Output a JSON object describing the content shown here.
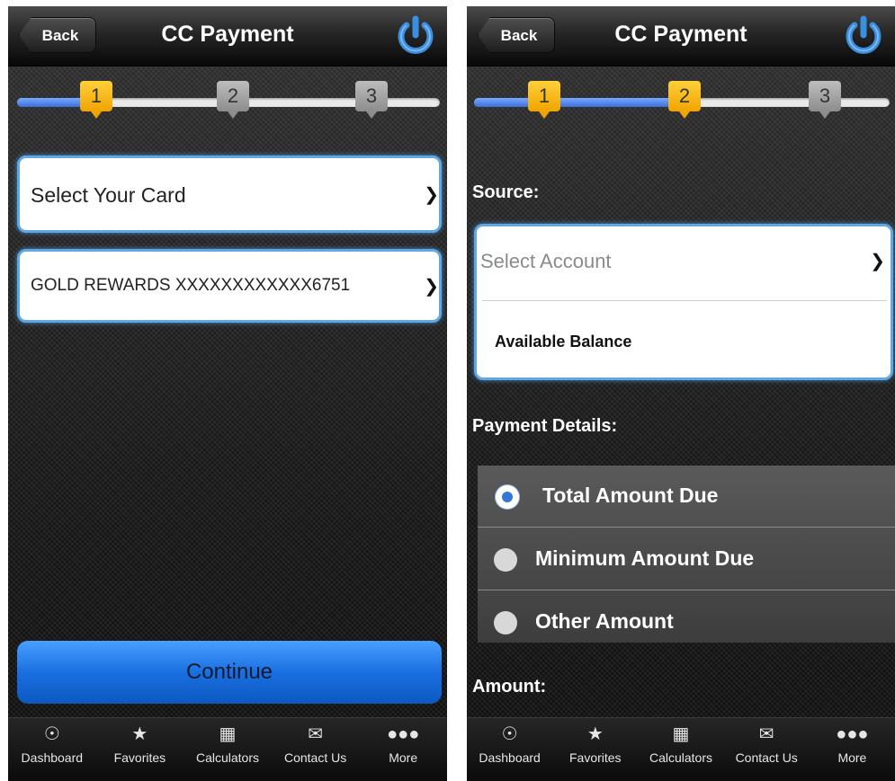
{
  "left": {
    "header": {
      "back_label": "Back",
      "title": "CC Payment"
    },
    "steps": [
      "1",
      "2",
      "3"
    ],
    "card_select": {
      "label": "Select Your Card"
    },
    "card_value": {
      "label": "GOLD REWARDS XXXXXXXXXXXX6751"
    },
    "continue_label": "Continue"
  },
  "right": {
    "header": {
      "back_label": "Back",
      "title": "CC Payment"
    },
    "steps": [
      "1",
      "2",
      "3"
    ],
    "source_label": "Source:",
    "account_select": {
      "placeholder": "Select Account",
      "balance_label": "Available Balance"
    },
    "payment_details_label": "Payment Details:",
    "payment_options": [
      {
        "label": "Total Amount Due",
        "selected": true
      },
      {
        "label": "Minimum Amount Due",
        "selected": false
      },
      {
        "label": "Other Amount",
        "selected": false
      }
    ],
    "amount_label": "Amount:"
  },
  "tabbar": [
    {
      "label": "Dashboard",
      "icon": "dashboard-icon"
    },
    {
      "label": "Favorites",
      "icon": "star-icon"
    },
    {
      "label": "Calculators",
      "icon": "calculator-icon"
    },
    {
      "label": "Contact Us",
      "icon": "contact-icon"
    },
    {
      "label": "More",
      "icon": "more-icon"
    }
  ],
  "colors": {
    "accent_blue": "#1a6fe0",
    "step_active": "#f0a400",
    "step_inactive": "#8d8d8d"
  }
}
